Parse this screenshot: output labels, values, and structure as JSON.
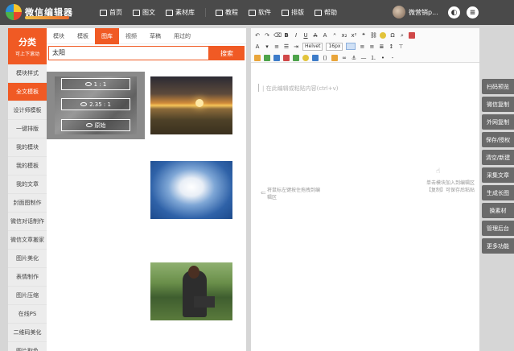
{
  "topbar": {
    "logo_text": "微信编辑器",
    "nav": [
      {
        "label": "首页",
        "icon": "home-icon"
      },
      {
        "label": "图文",
        "icon": "article-icon"
      },
      {
        "label": "素材库",
        "icon": "library-icon"
      },
      {
        "label": "教程",
        "icon": "tutorial-icon"
      },
      {
        "label": "软件",
        "icon": "software-icon"
      },
      {
        "label": "排版",
        "icon": "layout-icon"
      },
      {
        "label": "帮助",
        "icon": "help-icon"
      }
    ],
    "user_name": "微营销p...",
    "theme_icon": "theme-toggle-icon",
    "menu_icon": "menu-icon"
  },
  "categories": {
    "header_title": "分类",
    "header_sub": "可上下滚动",
    "items": [
      "模块样式",
      "全文模板",
      "设计师模板",
      "一键排版",
      "我的模块",
      "我的模板",
      "我的文章",
      "封面图制作",
      "微信对话制作",
      "微信文章搬家",
      "图片美化",
      "表情制作",
      "图片压缩",
      "在线PS",
      "二维码美化",
      "图片取色"
    ],
    "active_index": 1
  },
  "material": {
    "tabs": [
      "模块",
      "模板",
      "图库",
      "视频",
      "草稿",
      "用过的"
    ],
    "active_tab": 2,
    "search_value": "太阳",
    "search_button": "搜索",
    "overlay_buttons": [
      "1 : 1",
      "2.35 : 1",
      "原始"
    ]
  },
  "editor": {
    "font_name": "Helvet",
    "font_size": "16px",
    "placeholder": "|  在此编辑或粘贴内容(ctrl+v)",
    "drop_left": "将鼠标左键按住拖拽到编辑区",
    "drop_right": "单击模块加入到编辑区",
    "drop_right_2": "【复制】可保存后粘贴"
  },
  "actions": [
    "扫码预览",
    "微信复制",
    "外网复制",
    "保存/授权",
    "清空/新建",
    "采集文章",
    "生成长图",
    "换素材",
    "管理后台",
    "更多功能"
  ],
  "colors": {
    "accent": "#f05a24",
    "topbar": "#4a4a4a",
    "action": "#6a6a6a"
  }
}
